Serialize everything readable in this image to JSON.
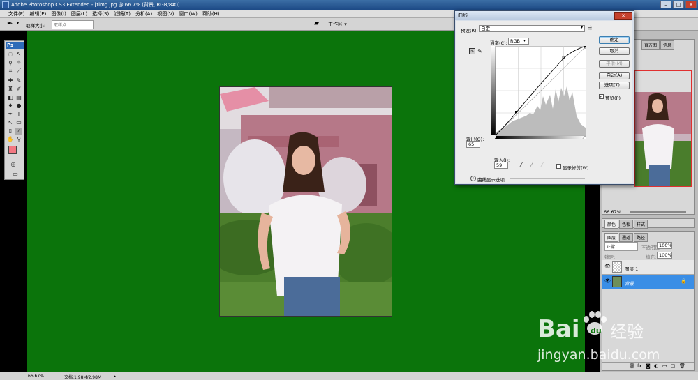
{
  "app": {
    "title": "Adobe Photoshop CS3 Extended - [timg.jpg @ 66.7% (背景, RGB/8#)]"
  },
  "menu": [
    "文件(F)",
    "编辑(E)",
    "图像(I)",
    "图层(L)",
    "选择(S)",
    "滤镜(T)",
    "分析(A)",
    "视图(V)",
    "窗口(W)",
    "帮助(H)"
  ],
  "options_bar": {
    "sample_size_label": "取样大小:",
    "sample_size_value": "取样点",
    "workspace_label": "工作区 ▾"
  },
  "toolbox": {
    "logo": "Ps"
  },
  "status": {
    "zoom": "66.67%",
    "doc_info": "文档:1.98M/2.98M"
  },
  "curves_dialog": {
    "title": "曲线",
    "preset_label": "预设(R):",
    "preset_value": "自定",
    "channel_label": "通道(C):",
    "channel_value": "RGB",
    "output_label": "输出(O):",
    "output_value": "65",
    "input_label": "输入(I):",
    "input_value": "59",
    "show_clipping_label": "显示修剪(W)",
    "curve_options_label": "曲线显示选项",
    "ok_label": "确定",
    "cancel_label": "取消",
    "smooth_label": "平滑(M)",
    "auto_label": "自动(A)",
    "options_label": "选项(T)...",
    "preview_label": "预览(P)",
    "preview_checked": true
  },
  "navigator_panel": {
    "tabs": [
      "导航器",
      "直方图",
      "信息"
    ],
    "zoom_value": "66.67%"
  },
  "color_panel": {
    "tabs": [
      "颜色",
      "色板",
      "样式"
    ]
  },
  "layers_panel": {
    "tabs": [
      "图层",
      "通道",
      "路径"
    ],
    "blend_mode": "正常",
    "opacity_label": "不透明度:",
    "opacity_value": "100%",
    "lock_label": "锁定:",
    "fill_label": "填充:",
    "fill_value": "100%",
    "layers": [
      {
        "name": "图层 1"
      },
      {
        "name": "背景"
      }
    ]
  },
  "watermark": {
    "brand_left": "Bai",
    "brand_right": "du",
    "brand_cn": "经验",
    "url": "jingyan.baidu.com"
  },
  "colors": {
    "canvas_bg": "#0b740b",
    "foreground_swatch": "#f27882",
    "layer_selected": "#3a8ee6"
  }
}
